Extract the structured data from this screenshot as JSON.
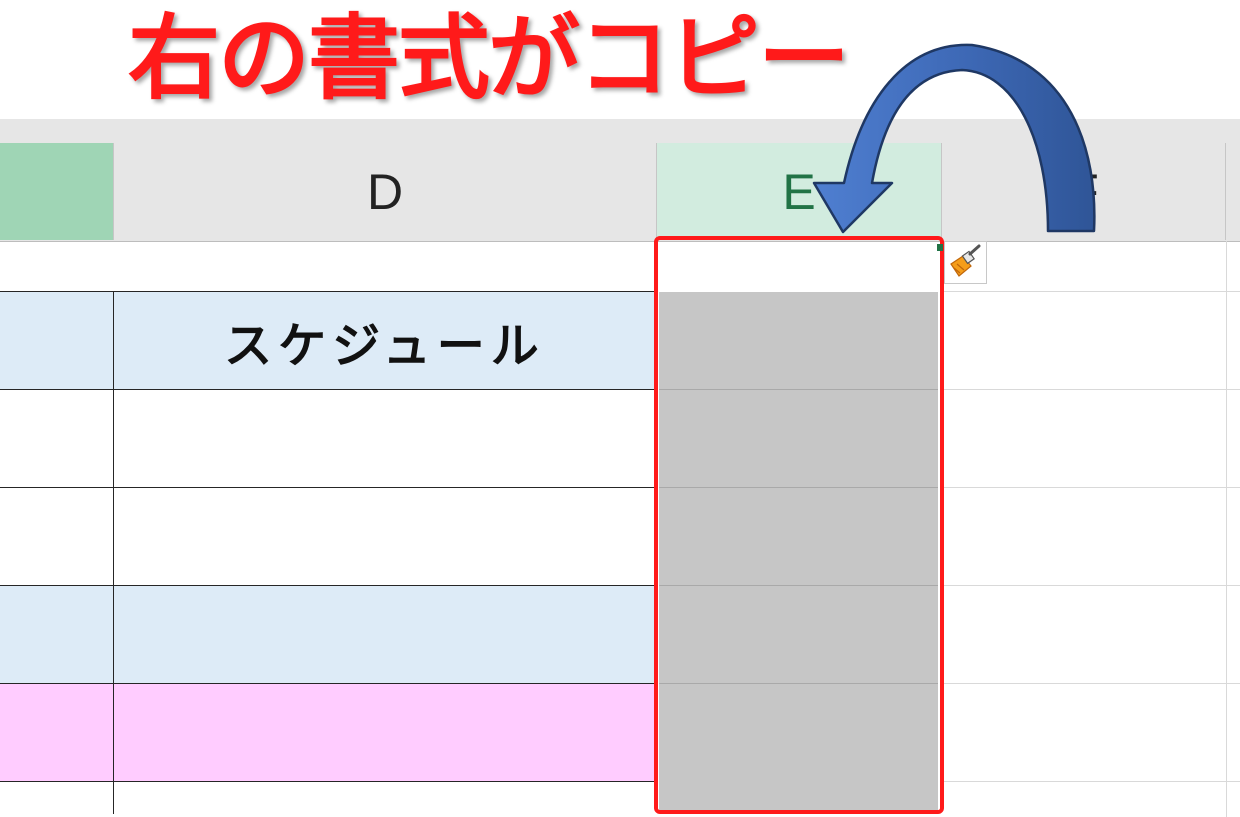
{
  "annotation": {
    "title": "右の書式がコピー"
  },
  "columns": {
    "c": "",
    "d": "D",
    "e": "E",
    "f": "F"
  },
  "cells": {
    "d_row1": "スケジュール"
  },
  "colors": {
    "title_red": "#ff1a1a",
    "header_gray": "#e6e6e6",
    "selected_header_green": "#d2ecdf",
    "col_c_header_green": "#9fd5b5",
    "row_blue": "#ddebf7",
    "row_pink": "#ffccff",
    "copied_gray": "#c6c6c6",
    "arrow_blue": "#4472c4",
    "fill_handle_green": "#217346"
  },
  "icons": {
    "format_painter": "paintbrush-icon",
    "curved_arrow": "curved-arrow-icon"
  }
}
